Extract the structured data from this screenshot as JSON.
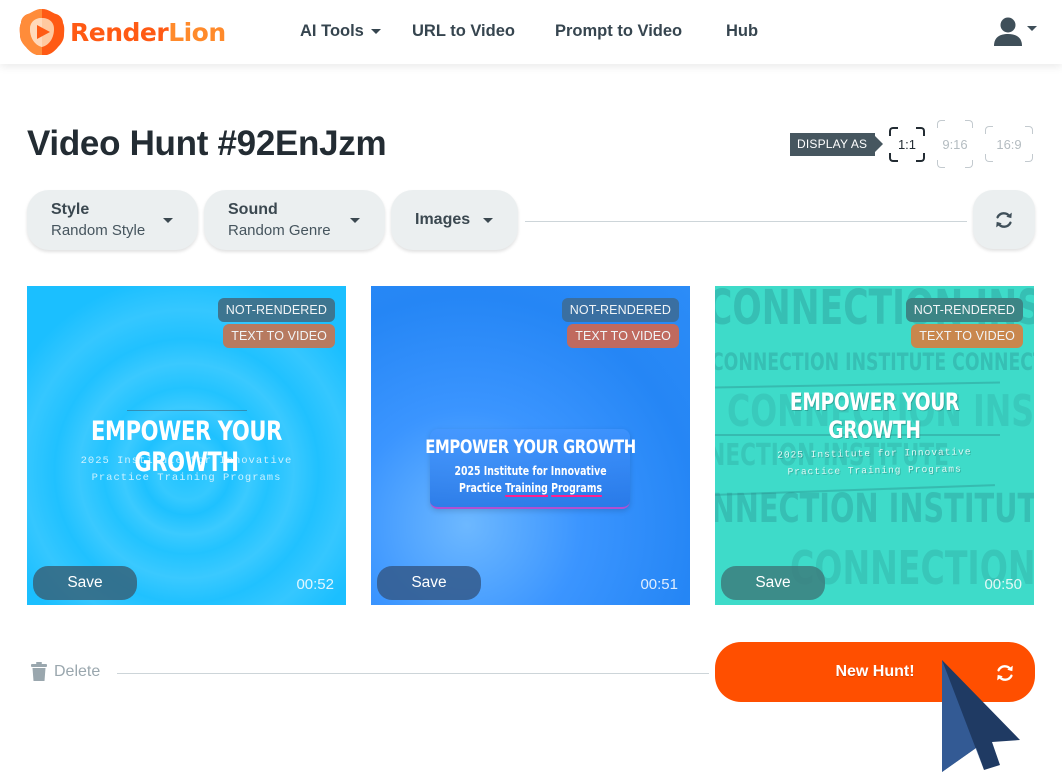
{
  "brand": {
    "name_part1": "Render",
    "name_part2": "Lion",
    "logo_icon": "lion-play-icon",
    "primary_color": "#ff4f00"
  },
  "nav": {
    "items": [
      {
        "label": "AI Tools",
        "has_dropdown": true
      },
      {
        "label": "URL to Video",
        "has_dropdown": false
      },
      {
        "label": "Prompt to Video",
        "has_dropdown": false
      },
      {
        "label": "Hub",
        "has_dropdown": false
      }
    ],
    "user_icon": "user-icon"
  },
  "page": {
    "title": "Video Hunt #92EnJzm",
    "display_as_label": "DISPLAY AS",
    "ratios": [
      {
        "label": "1:1",
        "active": true
      },
      {
        "label": "9:16",
        "active": false
      },
      {
        "label": "16:9",
        "active": false
      }
    ]
  },
  "filters": [
    {
      "label": "Style",
      "value": "Random Style"
    },
    {
      "label": "Sound",
      "value": "Random Genre"
    },
    {
      "label": "Images",
      "value": ""
    }
  ],
  "cards": [
    {
      "status": "NOT-RENDERED",
      "type": "TEXT TO VIDEO",
      "headline": "EMPOWER YOUR GROWTH",
      "subline_1": "2025 Institute for Innovative",
      "subline_2": "Practice Training Programs",
      "save_label": "Save",
      "duration": "00:52"
    },
    {
      "status": "NOT-RENDERED",
      "type": "TEXT TO VIDEO",
      "headline": "EMPOWER YOUR GROWTH",
      "subline_1": "2025 Institute for Innovative",
      "subline_2_a": "Practice ",
      "subline_2_b": "Training",
      "subline_2_c": " ",
      "subline_2_d": "Programs",
      "save_label": "Save",
      "duration": "00:51"
    },
    {
      "status": "NOT-RENDERED",
      "type": "TEXT TO VIDEO",
      "headline": "EMPOWER YOUR GROWTH",
      "subline_1": "2025 Institute for Innovative",
      "subline_2": "Practice Training Programs",
      "bg_text_1": "CONNECTION INSTITUTE",
      "bg_text_2": "CONNECTION INSTITUTE CONNECTION INSTITUTE",
      "bg_text_3": "CONNECTION INSTITUTE",
      "bg_text_4": "CONNECTION INSTITUTE",
      "bg_text_5": "CONNECTION INSTITUTE",
      "save_label": "Save",
      "duration": "00:50"
    }
  ],
  "footer": {
    "delete_label": "Delete",
    "new_hunt_label": "New Hunt!"
  }
}
